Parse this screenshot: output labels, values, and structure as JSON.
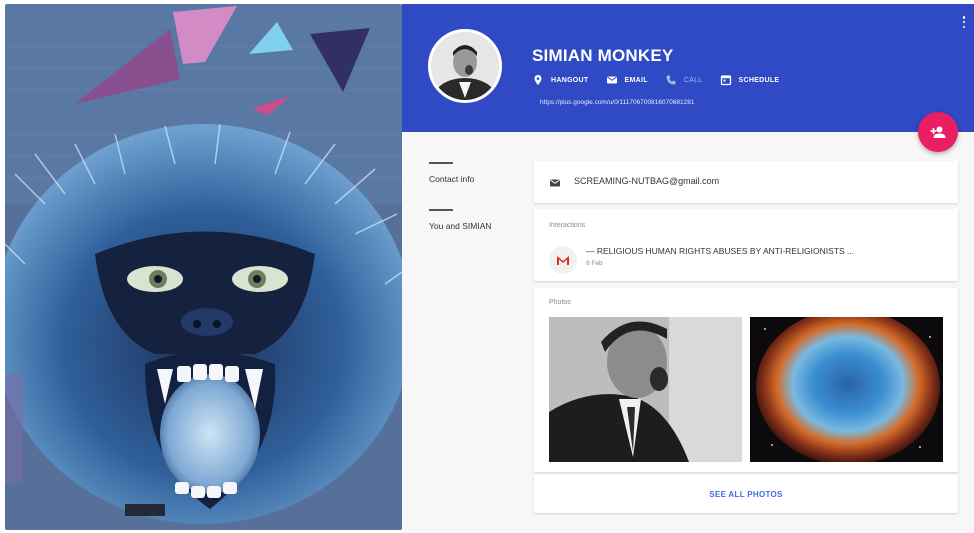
{
  "contact": {
    "name": "SIMIAN MONKEY",
    "profile_url": "https://plus.google.com/u/0/111706700816070681281",
    "actions": [
      {
        "label": "HANGOUT",
        "icon": "location-pin-icon"
      },
      {
        "label": "EMAIL",
        "icon": "email-icon"
      },
      {
        "label": "CALL",
        "icon": "phone-icon"
      },
      {
        "label": "SCHEDULE",
        "icon": "calendar-icon"
      }
    ]
  },
  "nav": {
    "contact_info": "Contact info",
    "you_and": "You and SIMIAN"
  },
  "email_card": {
    "address": "SCREAMING-NUTBAG@gmail.com"
  },
  "interactions": {
    "title": "Interactions",
    "subject": "— RELIGIOUS HUMAN RIGHTS ABUSES BY ANTI-RELIGIONISTS ...",
    "date": "9 Feb"
  },
  "photos": {
    "title": "Photos",
    "see_all": "SEE ALL PHOTOS"
  },
  "colors": {
    "header_blue": "#3049c4",
    "fab_pink": "#e91e63",
    "link_blue": "#3f6fd8"
  }
}
